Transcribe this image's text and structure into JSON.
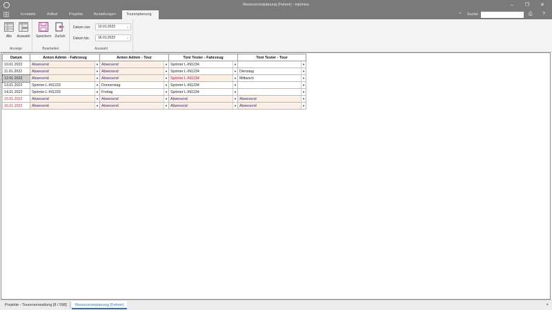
{
  "window": {
    "title": "Ressourcenplanung (Fahrer) - mjomius",
    "buttons": {
      "minimize": "–",
      "maximize": "❐",
      "close": "✕"
    }
  },
  "ribbon_tabs": {
    "items": [
      "Kontakte",
      "Artikel",
      "Projekte",
      "Bestellungen",
      "Tourenplanung"
    ],
    "active_index": 4,
    "search_label": "Suche:",
    "search_value": ""
  },
  "ribbon": {
    "groups": {
      "anzeige": {
        "label": "Anzeige",
        "buttons": [
          "Alle",
          "Auswahl"
        ]
      },
      "bearbeiten": {
        "label": "Bearbeiten",
        "buttons": [
          "Speichern",
          "Zurück"
        ]
      },
      "auswahl": {
        "label": "Auswahl",
        "datum_von_label": "Datum von:",
        "datum_von_value": "10.01.2022",
        "datum_bis_label": "Datum bis:",
        "datum_bis_value": "16.01.2022"
      }
    },
    "colors": {
      "save_icon": "#b8378c",
      "back_icon": "#444444"
    }
  },
  "grid": {
    "columns": [
      "Datum",
      "Anton Admin - Fahrzeug",
      "Anton Admin - Tour",
      "Toni Tester - Fahrzeug",
      "Toni Tester - Tour"
    ],
    "rows": [
      {
        "date": "10.01.2022",
        "cells": [
          "Abwesend",
          "Abwesend",
          "Sprinter L-IN1234",
          ""
        ],
        "status": [
          "abw",
          "abw",
          "normal",
          "normal"
        ],
        "bg": [
          "#fbeee3",
          "#fbeee3",
          "#ffffff",
          "#ffffff"
        ],
        "date_style": "normal",
        "selected": false
      },
      {
        "date": "11.01.2022",
        "cells": [
          "Abwesend",
          "Abwesend",
          "Sprinter L-IN1234",
          "Dienstag"
        ],
        "status": [
          "abw",
          "abw",
          "normal",
          "normal"
        ],
        "bg": [
          "#fbeee3",
          "#fbeee3",
          "#ffffff",
          "#ffffff"
        ],
        "date_style": "normal",
        "selected": false
      },
      {
        "date": "12.01.2022",
        "cells": [
          "Abwesend",
          "Abwesend",
          "Sprinter L-IN1234",
          "Mittwoch"
        ],
        "status": [
          "abw",
          "abw",
          "mag",
          "normal"
        ],
        "bg": [
          "#fbeee3",
          "#fbeee3",
          "#fbeee3",
          "#ffffff"
        ],
        "date_style": "normal",
        "selected": true
      },
      {
        "date": "13.01.2022",
        "cells": [
          "Sprinter L-IN1233",
          "Donnerstag",
          "Sprinter L-IN1234",
          ""
        ],
        "status": [
          "normal",
          "normal",
          "normal",
          "normal"
        ],
        "bg": [
          "#ffffff",
          "#ffffff",
          "#ffffff",
          "#ffffff"
        ],
        "date_style": "normal",
        "selected": false
      },
      {
        "date": "14.01.2022",
        "cells": [
          "Sprinter L-IN1233",
          "Freitag",
          "Sprinter L-IN1234",
          ""
        ],
        "status": [
          "normal",
          "normal",
          "normal",
          "normal"
        ],
        "bg": [
          "#ffffff",
          "#ffffff",
          "#ffffff",
          "#ffffff"
        ],
        "date_style": "normal",
        "selected": false
      },
      {
        "date": "15.01.2022",
        "cells": [
          "Abwesend",
          "Abwesend",
          "Abwesend",
          "Abwesend"
        ],
        "status": [
          "abw",
          "abw",
          "abw",
          "abw"
        ],
        "bg": [
          "#fbeee3",
          "#fbeee3",
          "#fbeee3",
          "#fbeee3"
        ],
        "date_style": "red",
        "selected": false
      },
      {
        "date": "16.01.2022",
        "cells": [
          "Abwesend",
          "Abwesend",
          "Abwesend",
          "Abwesend"
        ],
        "status": [
          "abw",
          "abw",
          "abw",
          "abw"
        ],
        "bg": [
          "#fbeee3",
          "#fbeee3",
          "#fbeee3",
          "#fbeee3"
        ],
        "date_style": "red",
        "selected": false
      }
    ]
  },
  "bottom_tabs": {
    "items": [
      "Projekte - Tourenverwaltung [8 / 598]",
      "Ressourcenplanung (Fahrer)"
    ],
    "active_index": 1
  }
}
